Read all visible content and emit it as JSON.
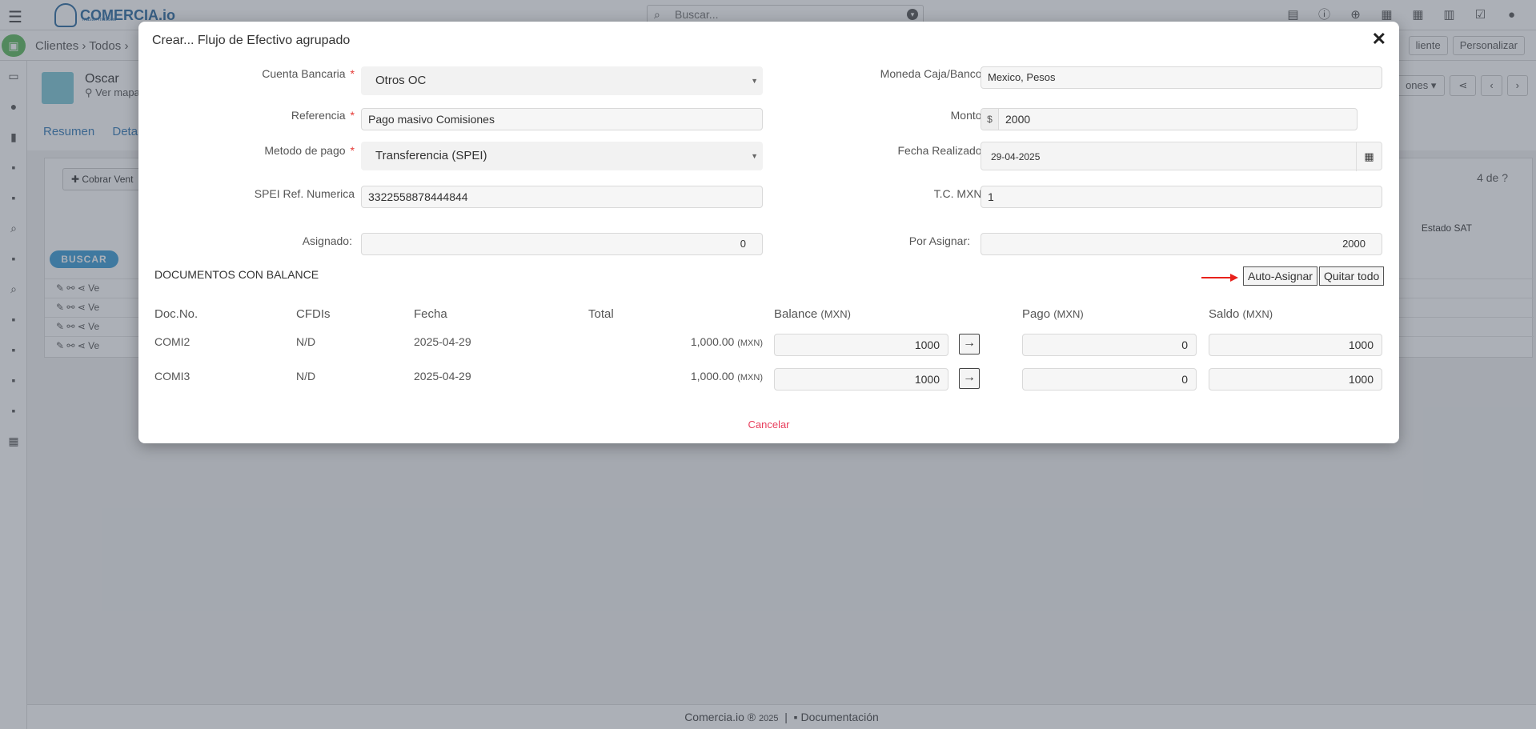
{
  "app": {
    "logo_text": "COMERCIA.io",
    "logo_sub": "master multisuc",
    "search_placeholder": "Buscar..."
  },
  "breadcrumb": {
    "items": "Clientes  ›  Todos  ›",
    "right_buttons": [
      "liente",
      "Personalizar"
    ]
  },
  "record": {
    "name": "Oscar",
    "map_link": "Ver mapa",
    "tabs": [
      "Resumen",
      "Detal"
    ],
    "actions": [
      "ones ▾",
      "share",
      "‹",
      "›"
    ]
  },
  "list": {
    "cobrar_label": "Cobrar Vent",
    "pager_text": "4  de",
    "col_estado": "Estado SAT",
    "buscar_label": "BUSCAR",
    "rows": [
      "Ve",
      "Ve",
      "Ve",
      "Ve"
    ]
  },
  "footer": {
    "brand": "Comercia.io ®",
    "year": "2025",
    "separator": "|",
    "docs": "Documentación"
  },
  "modal": {
    "title": "Crear... Flujo de Efectivo agrupado",
    "close": "✕",
    "fields": {
      "cuenta_bancaria": {
        "label": "Cuenta Bancaria",
        "value": "Otros OC"
      },
      "moneda": {
        "label": "Moneda Caja/Banco",
        "value": "Mexico, Pesos"
      },
      "referencia": {
        "label": "Referencia",
        "value": "Pago masivo Comisiones"
      },
      "monto": {
        "label": "Monto",
        "prefix": "$",
        "value": "2000"
      },
      "metodo_pago": {
        "label": "Metodo de pago",
        "value": "Transferencia (SPEI)"
      },
      "fecha_realizado": {
        "label": "Fecha Realizado",
        "value": "29-04-2025"
      },
      "spei_ref": {
        "label": "SPEI Ref. Numerica",
        "value": "3322558878444844"
      },
      "tc_mxn": {
        "label": "T.C. MXN",
        "value": "1"
      },
      "asignado": {
        "label": "Asignado:",
        "value": "0"
      },
      "por_asignar": {
        "label": "Por Asignar:",
        "value": "2000"
      }
    },
    "required_mark": "*",
    "docs_title": "DOCUMENTOS CON BALANCE",
    "auto_asignar": "Auto-Asignar",
    "quitar_todo": "Quitar todo",
    "columns": {
      "doc_no": "Doc.No.",
      "cfdis": "CFDIs",
      "fecha": "Fecha",
      "total": "Total",
      "balance": "Balance",
      "pago": "Pago",
      "saldo": "Saldo",
      "currency": "(MXN)"
    },
    "rows": [
      {
        "doc_no": "COMI2",
        "cfdis": "N/D",
        "fecha": "2025-04-29",
        "total": "1,000.00",
        "currency": "(MXN)",
        "balance": "1000",
        "pago": "0",
        "saldo": "1000"
      },
      {
        "doc_no": "COMI3",
        "cfdis": "N/D",
        "fecha": "2025-04-29",
        "total": "1,000.00",
        "currency": "(MXN)",
        "balance": "1000",
        "pago": "0",
        "saldo": "1000"
      }
    ],
    "cancel": "Cancelar"
  },
  "colors": {
    "required": "#e53935",
    "cancel_link": "#e83e5c",
    "annotation_arrow": "#e8211b",
    "buscar_button": "#3a9bd5"
  }
}
